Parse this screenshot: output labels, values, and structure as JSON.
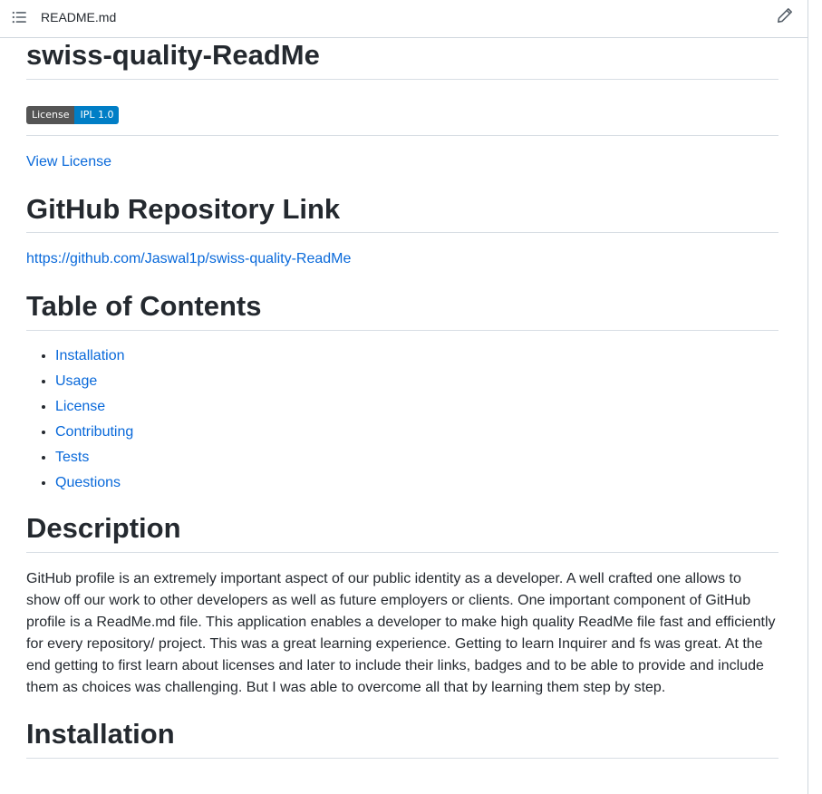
{
  "file_header": {
    "filename": "README.md",
    "toc_icon": "list-unordered-icon",
    "edit_icon": "pencil-icon"
  },
  "readme": {
    "title": "swiss-quality-ReadMe",
    "badge": {
      "label": "License",
      "value": "IPL 1.0",
      "label_color": "#555555",
      "value_color": "#007ec6"
    },
    "view_license": "View License",
    "repo_heading": "GitHub Repository Link",
    "repo_url": "https://github.com/Jaswal1p/swiss-quality-ReadMe",
    "toc_heading": "Table of Contents",
    "toc_items": [
      "Installation",
      "Usage",
      "License",
      "Contributing",
      "Tests",
      "Questions"
    ],
    "description_heading": "Description",
    "description_lines": [
      "GitHub profile is an extremely important aspect of our public identity as a developer. A well crafted one allows to",
      "show off our work to other developers as well as future employers or clients. One important component of GitHub",
      "profile is a ReadMe.md file. This application enables a developer to make high quality ReadMe file fast and efficiently",
      "for every repository/ project. This was a great learning experience. Getting to learn Inquirer and fs was great. At the",
      "end getting to first learn about licenses and later to include their links, badges and to be able to provide and include",
      "them as choices was challenging. But I was able to overcome all that by learning them step by step."
    ],
    "installation_heading": "Installation"
  },
  "colors": {
    "link": "#0969da",
    "text": "#24292f",
    "border": "#d0d7de"
  }
}
